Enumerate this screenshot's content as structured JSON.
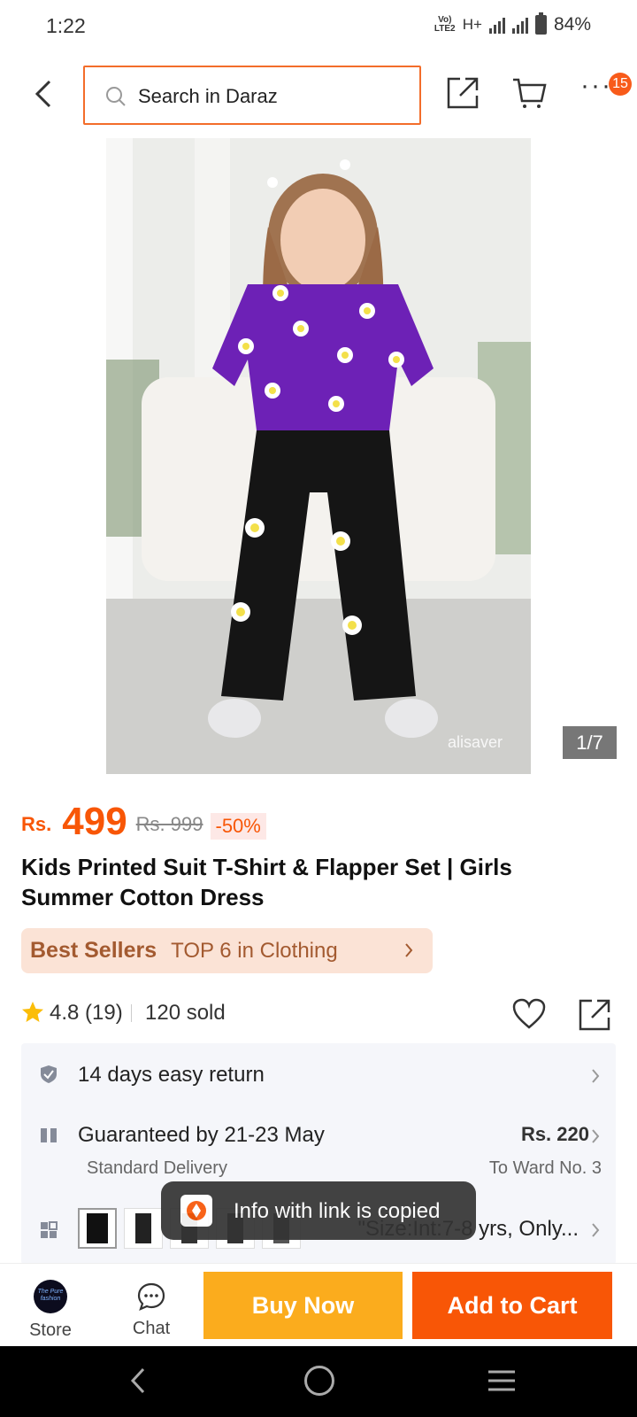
{
  "status_bar": {
    "time": "1:22",
    "network": "H+",
    "volte": "Vo) LTE2",
    "battery": "84%"
  },
  "header": {
    "search_placeholder": "Search in Daraz",
    "cart_badge": "15"
  },
  "gallery": {
    "counter": "1/7",
    "watermark": "alisaver"
  },
  "price": {
    "currency": "Rs.",
    "value": "499",
    "original": "Rs. 999",
    "discount": "-50%"
  },
  "product": {
    "title": "Kids Printed Suit T-Shirt & Flapper Set | Girls Summer Cotton Dress"
  },
  "best_sellers": {
    "title": "Best Sellers",
    "desc": "TOP 6 in Clothing"
  },
  "rating": {
    "value": "4.8 (19)",
    "sold": "120 sold"
  },
  "info": {
    "return": "14 days easy return",
    "delivery": {
      "guarantee": "Guaranteed by 21-23 May",
      "fee": "Rs. 220",
      "type": "Standard Delivery",
      "destination": "To Ward No. 3"
    },
    "variant_text": "\"Size:Int:7-8 yrs, Only..."
  },
  "toast": {
    "text": "Info with link is copied"
  },
  "bottom_bar": {
    "store_label": "Store",
    "store_logo_text": "The Pure fashion",
    "chat_label": "Chat",
    "buy_now": "Buy Now",
    "add_to_cart": "Add to Cart"
  },
  "colors": {
    "accent": "#f85606",
    "buy_now": "#fbac1d",
    "search_border": "#f36d2a"
  }
}
